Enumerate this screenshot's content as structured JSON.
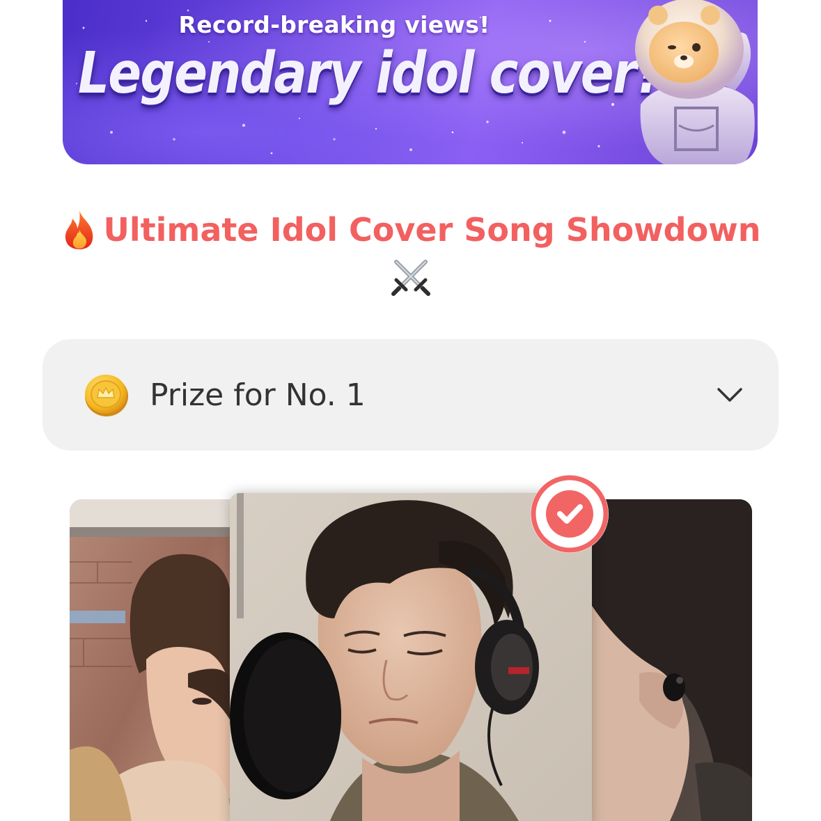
{
  "banner": {
    "subtitle": "Record-breaking views!",
    "headline": "Legendary idol cover?",
    "mascot_icon": "astronaut-bear-mascot"
  },
  "section": {
    "title_emoji_icon": "fire-icon",
    "title": "Ultimate Idol Cover Song Showdown",
    "title_trailing_icon": "crossed-swords-icon",
    "title_color": "#f26060"
  },
  "prize": {
    "icon": "gold-coin-crown-icon",
    "label": "Prize for No. 1",
    "toggle_icon": "chevron-down-icon"
  },
  "carousel": {
    "cards": [
      {
        "position": "left",
        "image": "singer-with-bangs-photo"
      },
      {
        "position": "center",
        "image": "singer-at-microphone-with-headphones-photo",
        "selected": true
      },
      {
        "position": "right",
        "image": "singer-with-in-ear-monitor-photo"
      }
    ],
    "selected_badge_icon": "check-circle-icon",
    "accent_color": "#f26565"
  }
}
